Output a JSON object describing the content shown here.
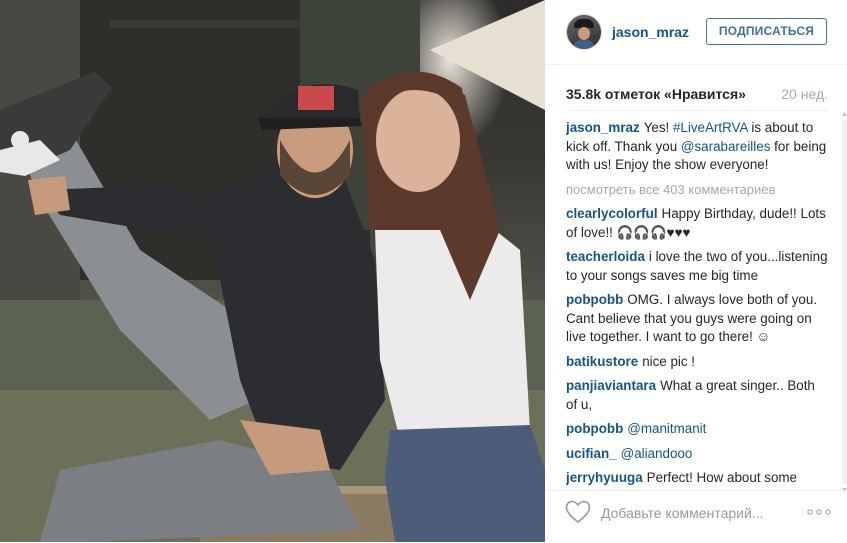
{
  "post": {
    "username": "jason_mraz",
    "follow_label": "ПОДПИСАТЬСЯ",
    "likes": "35.8k отметок «Нравится»",
    "age": "20 нед.",
    "caption": {
      "username": "jason_mraz",
      "text_1": "Yes! ",
      "hashtag": "#LiveArtRVA",
      "text_2": " is about to kick off. Thank you ",
      "mention": "@sarabareilles",
      "text_3": " for being with us! Enjoy the show everyone!"
    },
    "view_all": "посмотреть все 403 комментариев",
    "comments": [
      {
        "user": "clearlycolorful",
        "text": "Happy Birthday, dude!! Lots of love!! 🎧🎧🎧♥♥♥"
      },
      {
        "user": "teacherloida",
        "text": "i love the two of you...listening to your songs saves me big time"
      },
      {
        "user": "pobpobb",
        "text": "OMG. I always love both of you. Cant believe that you guys were going on live together. I want to go there! ☺"
      },
      {
        "user": "batikustore",
        "text": "nice pic !"
      },
      {
        "user": "panjiaviantara",
        "text": "What a great singer.. Both of u,"
      },
      {
        "user": "pobpobb",
        "mention": "@manitmanit"
      },
      {
        "user": "ucifian_",
        "mention": "@aliandooo"
      },
      {
        "user": "jerryhyuuga",
        "text": "Perfect! How about some future collaboration with Vanessa"
      }
    ],
    "add_comment_placeholder": "Добавьте комментарий..."
  }
}
